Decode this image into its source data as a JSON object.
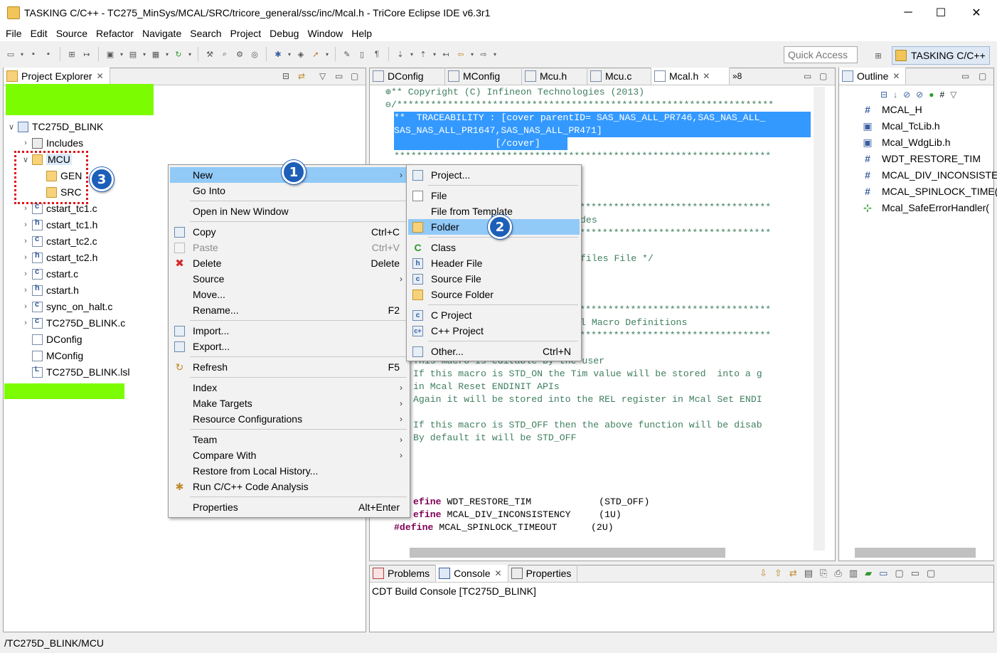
{
  "window": {
    "title": "TASKING C/C++ - TC275_MinSys/MCAL/SRC/tricore_general/ssc/inc/Mcal.h - TriCore Eclipse IDE v6.3r1",
    "min": "─",
    "max": "☐",
    "close": "✕"
  },
  "menu": [
    "File",
    "Edit",
    "Source",
    "Refactor",
    "Navigate",
    "Search",
    "Project",
    "Debug",
    "Window",
    "Help"
  ],
  "toolbar": {
    "quick_access_placeholder": "Quick Access",
    "perspective_label": "TASKING C/C++"
  },
  "explorer": {
    "tab_label": "Project Explorer",
    "project": "TC275D_BLINK",
    "items": [
      "Includes",
      "MCU",
      "GEN",
      "SRC",
      "cstart_tc1.c",
      "cstart_tc1.h",
      "cstart_tc2.c",
      "cstart_tc2.h",
      "cstart.c",
      "cstart.h",
      "sync_on_halt.c",
      "TC275D_BLINK.c",
      "DConfig",
      "MConfig",
      "TC275D_BLINK.lsl"
    ]
  },
  "editor": {
    "tabs": [
      "DConfig",
      "MConfig",
      "Mcu.h",
      "Mcu.c",
      "Mcal.h"
    ],
    "overflow": "»8",
    "lines": {
      "l1": "** Copyright (C) Infineon Technologies (2013)",
      "l2": "/*******************************************************************",
      "l3": "**  TRACEABILITY : [cover parentID= SAS_NAS_ALL_PR746,SAS_NAS_ALL_",
      "l4": "SAS_NAS_ALL_PR1647,SAS_NAS_ALL_PR471]",
      "l5": "                  [/cover]",
      "l6": "*******************************************************************",
      "frag_des": "des",
      "frag_files": "files File */",
      "frag_macro": "l Macro Definitions",
      "t1": "This macro is editable by the user",
      "t2": "If this macro is STD_ON the Tim value will be stored  into a g",
      "t3": "in Mcal Reset ENDINIT APIs",
      "t4": "Again it will be stored into the REL register in Mcal Set ENDI",
      "t5": "If this macro is STD_OFF then the above function will be disab",
      "t6": "By default it will be STD_OFF",
      "d1_kw": "efine",
      "d1_rest": " WDT_RESTORE_TIM            (STD_OFF)",
      "d2_kw": "efine",
      "d2_rest": " MCAL_DIV_INCONSISTENCY     (1U)",
      "d3_kw": "#define",
      "d3_rest": " MCAL_SPINLOCK_TIMEOUT      (2U)"
    }
  },
  "context_menu": {
    "items": [
      {
        "label": "New",
        "arrow": "›"
      },
      {
        "label": "Go Into"
      },
      {
        "label": "Open in New Window"
      },
      {
        "label": "Copy",
        "acc": "Ctrl+C"
      },
      {
        "label": "Paste",
        "acc": "Ctrl+V"
      },
      {
        "label": "Delete",
        "acc": "Delete"
      },
      {
        "label": "Source",
        "arrow": "›"
      },
      {
        "label": "Move..."
      },
      {
        "label": "Rename...",
        "acc": "F2"
      },
      {
        "label": "Import..."
      },
      {
        "label": "Export..."
      },
      {
        "label": "Refresh",
        "acc": "F5"
      },
      {
        "label": "Index",
        "arrow": "›"
      },
      {
        "label": "Make Targets",
        "arrow": "›"
      },
      {
        "label": "Resource Configurations",
        "arrow": "›"
      },
      {
        "label": "Team",
        "arrow": "›"
      },
      {
        "label": "Compare With",
        "arrow": "›"
      },
      {
        "label": "Restore from Local History..."
      },
      {
        "label": "Run C/C++ Code Analysis"
      },
      {
        "label": "Properties",
        "acc": "Alt+Enter"
      }
    ]
  },
  "submenu": {
    "items": [
      {
        "label": "Project..."
      },
      {
        "label": "File"
      },
      {
        "label": "File from Template"
      },
      {
        "label": "Folder"
      },
      {
        "label": "Class"
      },
      {
        "label": "Header File"
      },
      {
        "label": "Source File"
      },
      {
        "label": "Source Folder"
      },
      {
        "label": "C Project"
      },
      {
        "label": "C++ Project"
      },
      {
        "label": "Other...",
        "acc": "Ctrl+N"
      }
    ]
  },
  "outline": {
    "tab_label": "Outline",
    "items": [
      {
        "icon": "#",
        "label": "MCAL_H"
      },
      {
        "icon": "▣",
        "label": "Mcal_TcLib.h"
      },
      {
        "icon": "▣",
        "label": "Mcal_WdgLib.h"
      },
      {
        "icon": "#",
        "label": "WDT_RESTORE_TIM"
      },
      {
        "icon": "#",
        "label": "MCAL_DIV_INCONSISTE"
      },
      {
        "icon": "#",
        "label": "MCAL_SPINLOCK_TIME("
      },
      {
        "icon": "⊹",
        "label": "Mcal_SafeErrorHandler("
      }
    ]
  },
  "bottom": {
    "tabs": [
      "Problems",
      "Console",
      "Properties"
    ],
    "console_title": "CDT Build Console [TC275D_BLINK]"
  },
  "badges": [
    "1",
    "2",
    "3"
  ],
  "status": "/TC275D_BLINK/MCU",
  "colors": {
    "selection_blue": "#3399ff",
    "menu_highlight": "#91c9f7",
    "redaction_green": "#7cfc00",
    "annotation_red": "#e0141c",
    "badge_blue": "#1d5fb8",
    "comment_green": "#3f7f5f",
    "keyword_purple": "#7f0055"
  }
}
